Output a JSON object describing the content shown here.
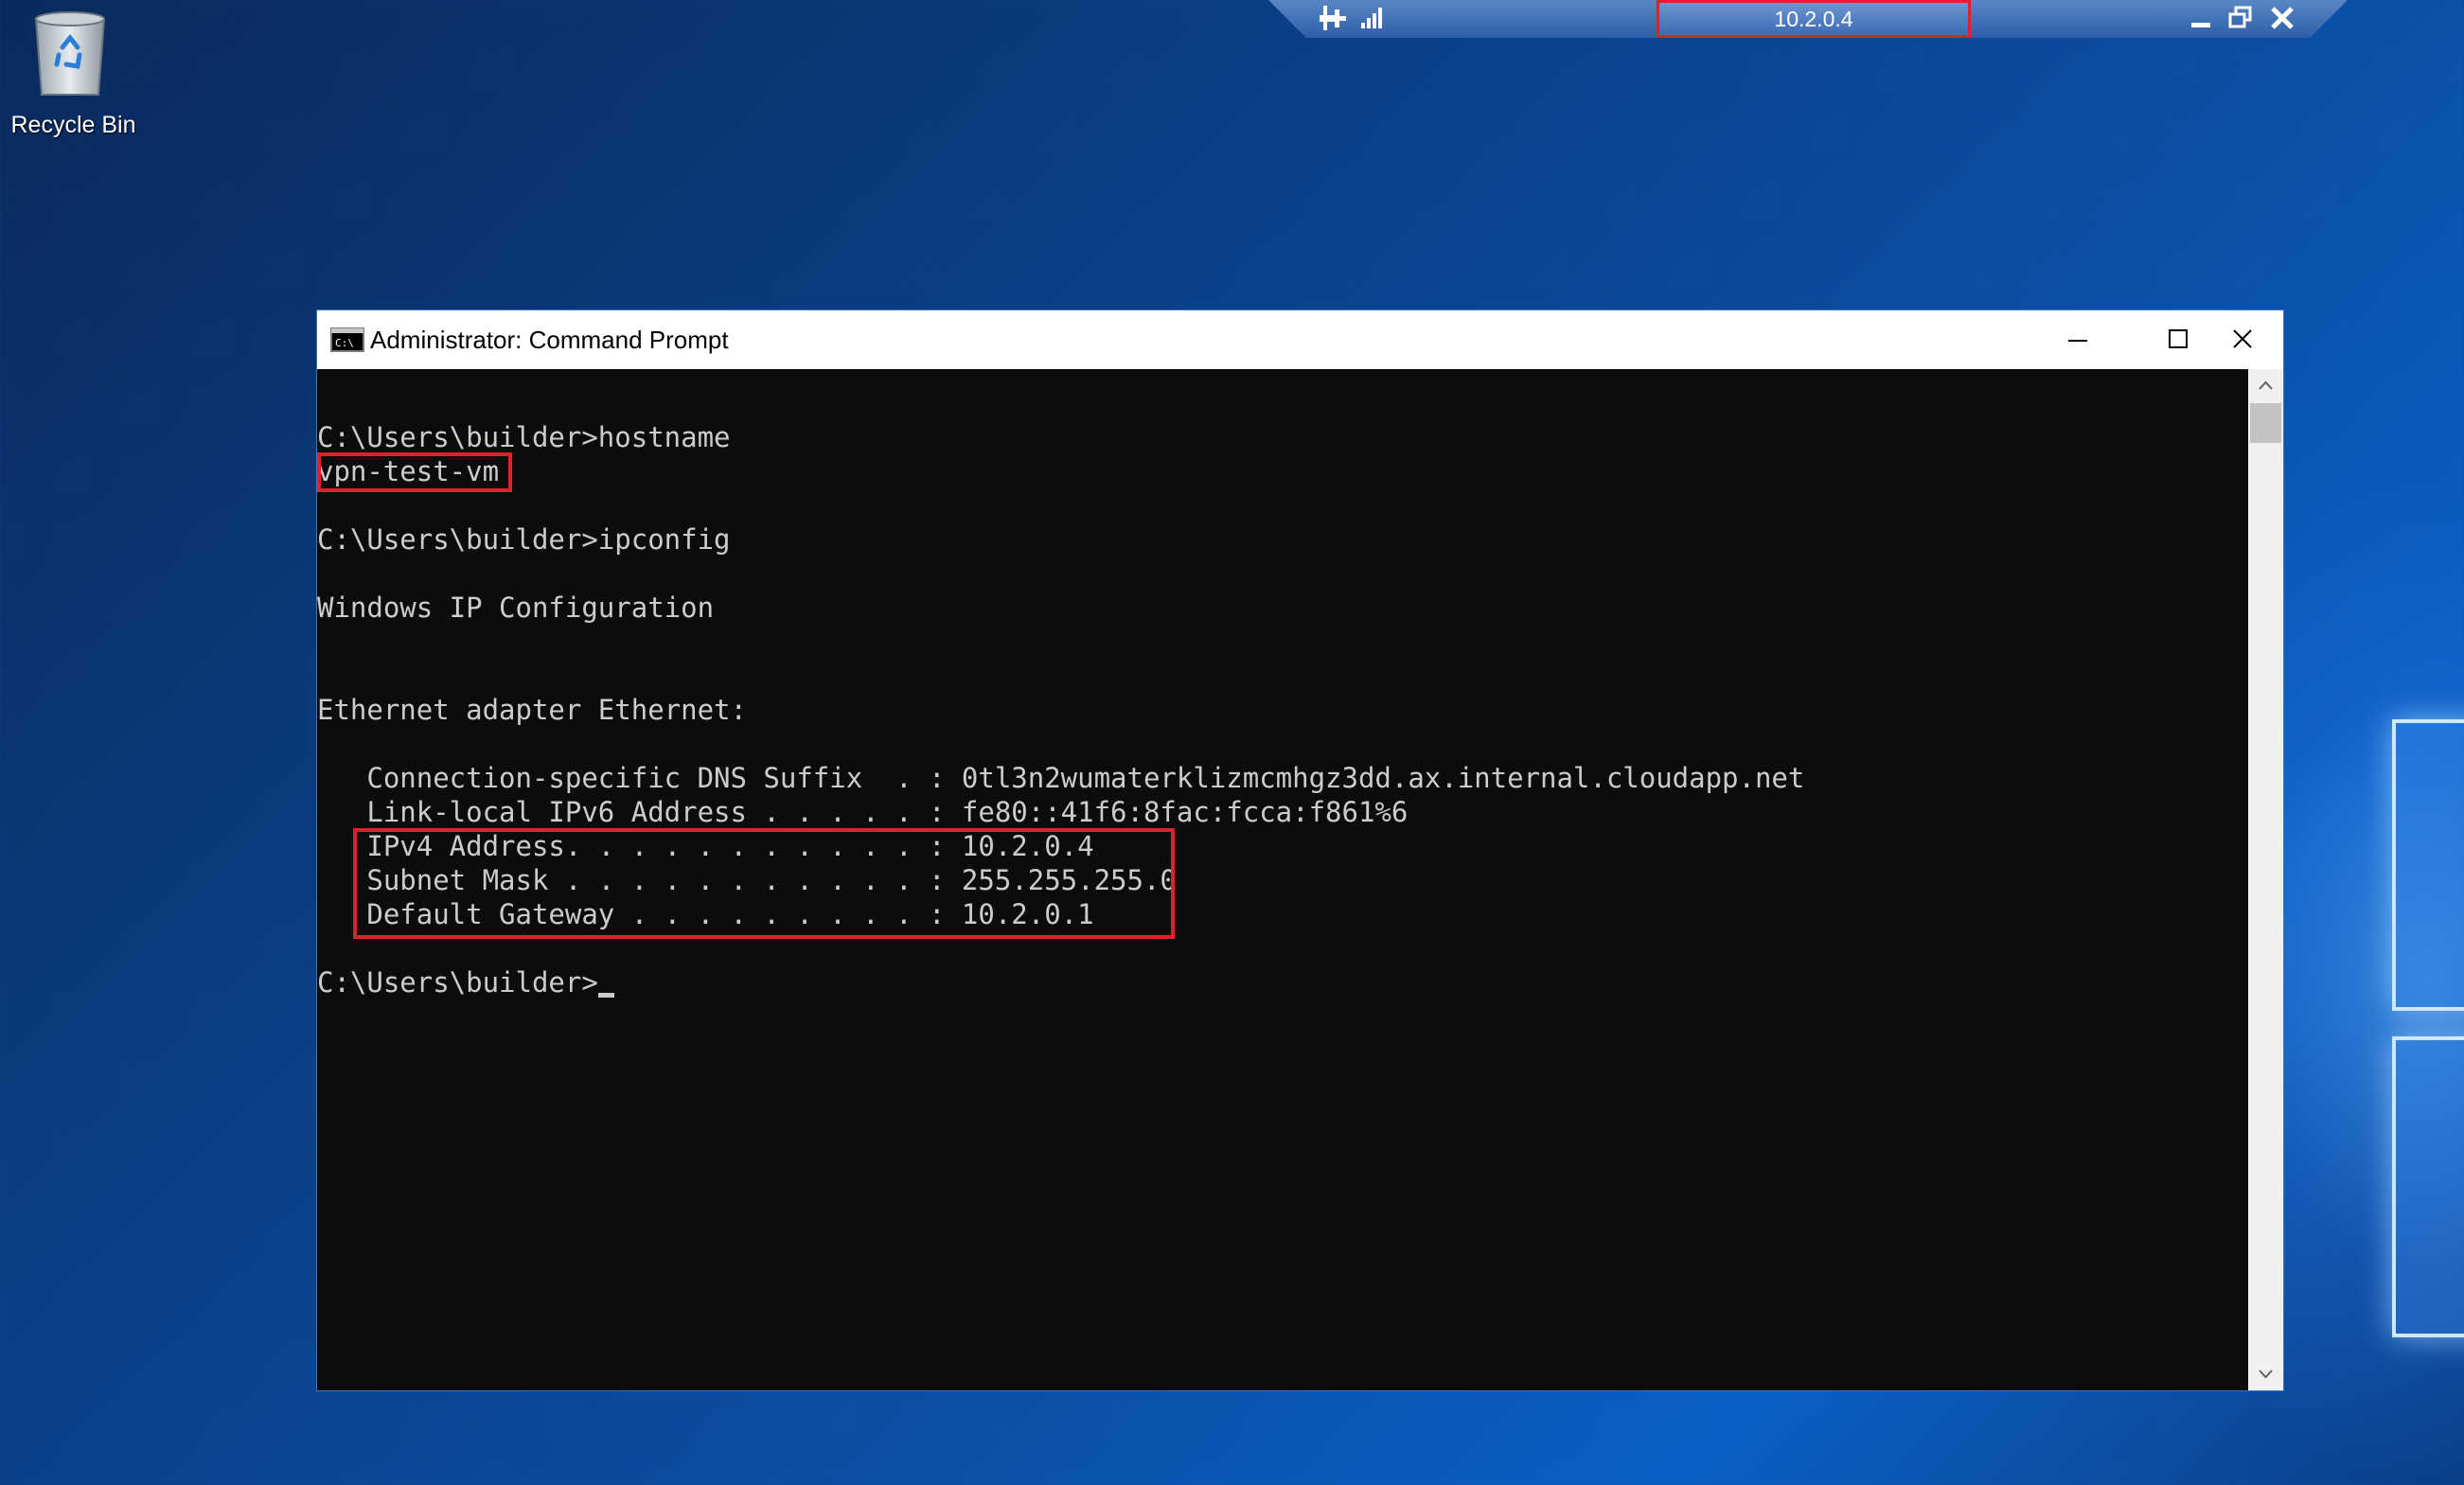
{
  "desktop": {
    "icons": [
      {
        "label": "Recycle Bin",
        "icon": "recycle-bin-icon"
      }
    ]
  },
  "rdp_bar": {
    "title": "10.2.0.4",
    "icons": [
      "pin-icon",
      "signal-strength-icon",
      "minimize-icon",
      "restore-icon",
      "close-icon"
    ]
  },
  "cmd_window": {
    "title": "Administrator: Command Prompt",
    "icon": "command-prompt-icon",
    "lines": [
      "C:\\Users\\builder>hostname",
      "vpn-test-vm",
      "",
      "C:\\Users\\builder>ipconfig",
      "",
      "Windows IP Configuration",
      "",
      "",
      "Ethernet adapter Ethernet:",
      "",
      "   Connection-specific DNS Suffix  . : 0tl3n2wumaterklizmcmhgz3dd.ax.internal.cloudapp.net",
      "   Link-local IPv6 Address . . . . . : fe80::41f6:8fac:fcca:f861%6",
      "   IPv4 Address. . . . . . . . . . . : 10.2.0.4",
      "   Subnet Mask . . . . . . . . . . . : 255.255.255.0",
      "   Default Gateway . . . . . . . . . : 10.2.0.1",
      "",
      "C:\\Users\\builder>"
    ]
  },
  "colors": {
    "highlight": "#e0202a",
    "console_bg": "#0c0c0c",
    "console_fg": "#cccccc",
    "desktop_bg": "#0b3f86"
  }
}
